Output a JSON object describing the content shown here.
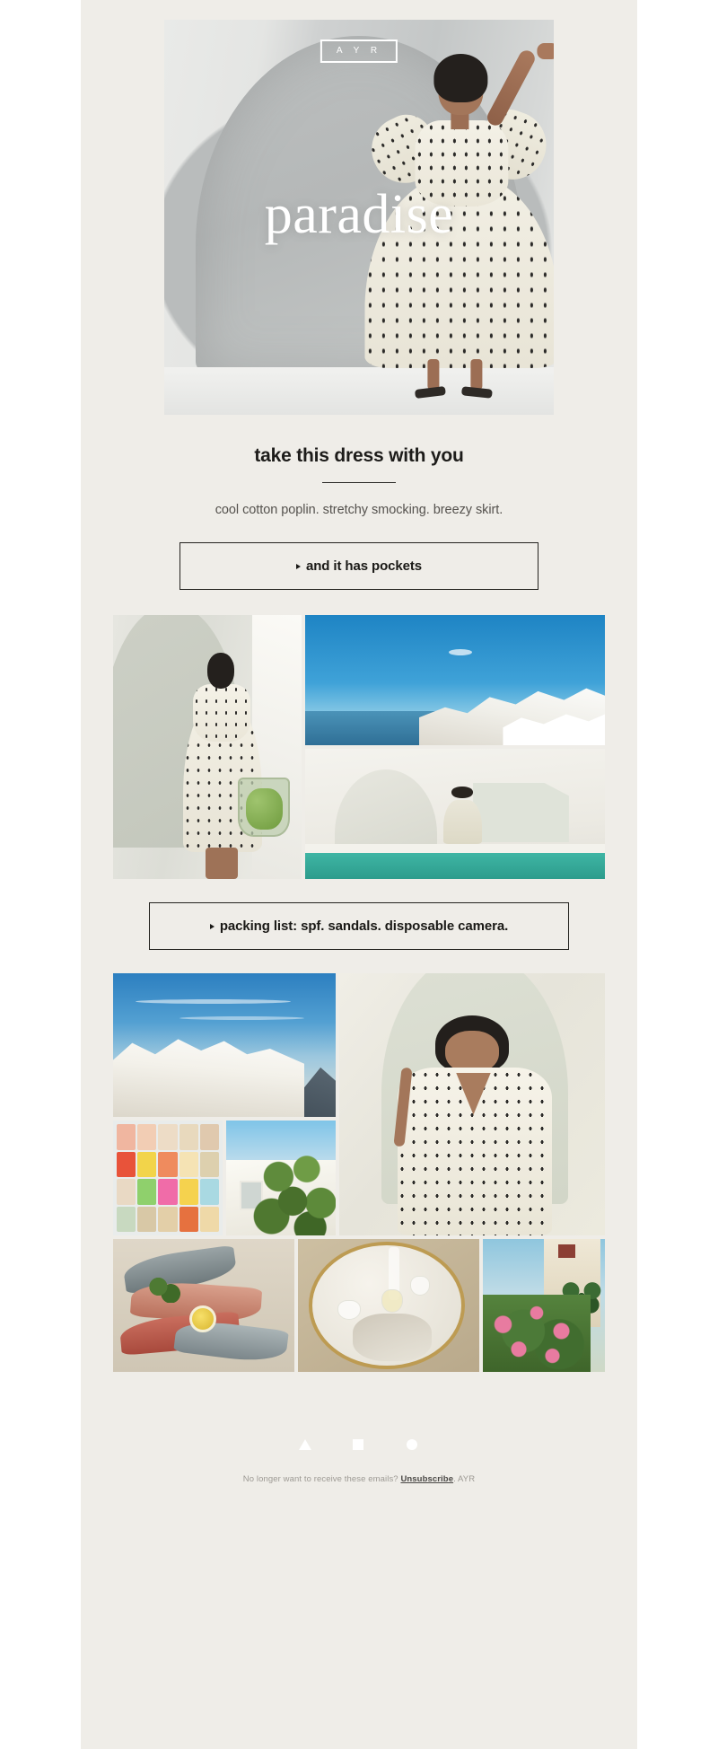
{
  "brand": {
    "logo_text": "A Y R",
    "logo_name": "ayr-logo"
  },
  "hero": {
    "overlay_word": "paradise",
    "alt": "model in black-dotted cotton poplin midi dress standing under a white arch"
  },
  "intro": {
    "headline": "take this dress with you",
    "subcopy": "cool cotton poplin. stretchy smocking. breezy skirt."
  },
  "cta_primary": {
    "label": "and it has pockets",
    "bullet": "triangle-right"
  },
  "cta_secondary": {
    "label": "packing list: spf. sandals. disposable camera.",
    "bullet": "triangle-right"
  },
  "gallery_one": [
    {
      "name": "model-with-tote-photo",
      "alt": "model in dotted dress holding a green mesh tote in a sunlit alley"
    },
    {
      "name": "santorini-sea-view-photo",
      "alt": "white cliffside village over deep blue aegean sea"
    },
    {
      "name": "poolside-arch-photo",
      "alt": "woman walking beside a turquoise pool framed by white arches"
    }
  ],
  "gallery_two": [
    {
      "name": "santorini-cliff-village-photo",
      "alt": "whitewashed village cascading down a santorini cliff"
    },
    {
      "name": "popsicle-freezer-photo",
      "alt": "rows of brightly colored popsicles in a freezer case"
    },
    {
      "name": "lemon-tree-photo",
      "alt": "lemon tree against a whitewashed wall under blue sky"
    },
    {
      "name": "model-portrait-photo",
      "alt": "close portrait of model in the dotted poplin dress by a white arch"
    },
    {
      "name": "fresh-fish-photo",
      "alt": "platter of fresh whole fish with lemon and parsley"
    },
    {
      "name": "wine-glasses-table-photo",
      "alt": "wine glasses casting shadows on a round marble cafe table"
    },
    {
      "name": "oleander-palm-photo",
      "alt": "pink oleander blossoms and a palm tree beside a pale building"
    }
  ],
  "popsicle_colors": [
    "#f0b6a0",
    "#f2cdb4",
    "#eddcc6",
    "#e8d9bd",
    "#e0c9ae",
    "#e8533a",
    "#f2d44a",
    "#ef8b5e",
    "#f5e3b4",
    "#ddd0ae",
    "#e9d9c4",
    "#8fd06c",
    "#f06ca8",
    "#f5d24e",
    "#a9d9e2",
    "#c8d9c0",
    "#d8c8a6",
    "#e3cfa8",
    "#e6713f",
    "#efd9a8"
  ],
  "social": [
    {
      "name": "social-triangle-icon",
      "shape": "triangle"
    },
    {
      "name": "social-square-icon",
      "shape": "square"
    },
    {
      "name": "social-circle-icon",
      "shape": "circle"
    }
  ],
  "footer": {
    "prefix": "No longer want to receive these emails?",
    "unsubscribe": "Unsubscribe",
    "suffix": ". AYR"
  },
  "colors": {
    "page_background": "#ffffff",
    "body_background": "#efede8",
    "text_dark": "#1d1c1a",
    "text_muted": "#55524e",
    "footer_text": "#9d9a94",
    "border": "#24231f"
  }
}
